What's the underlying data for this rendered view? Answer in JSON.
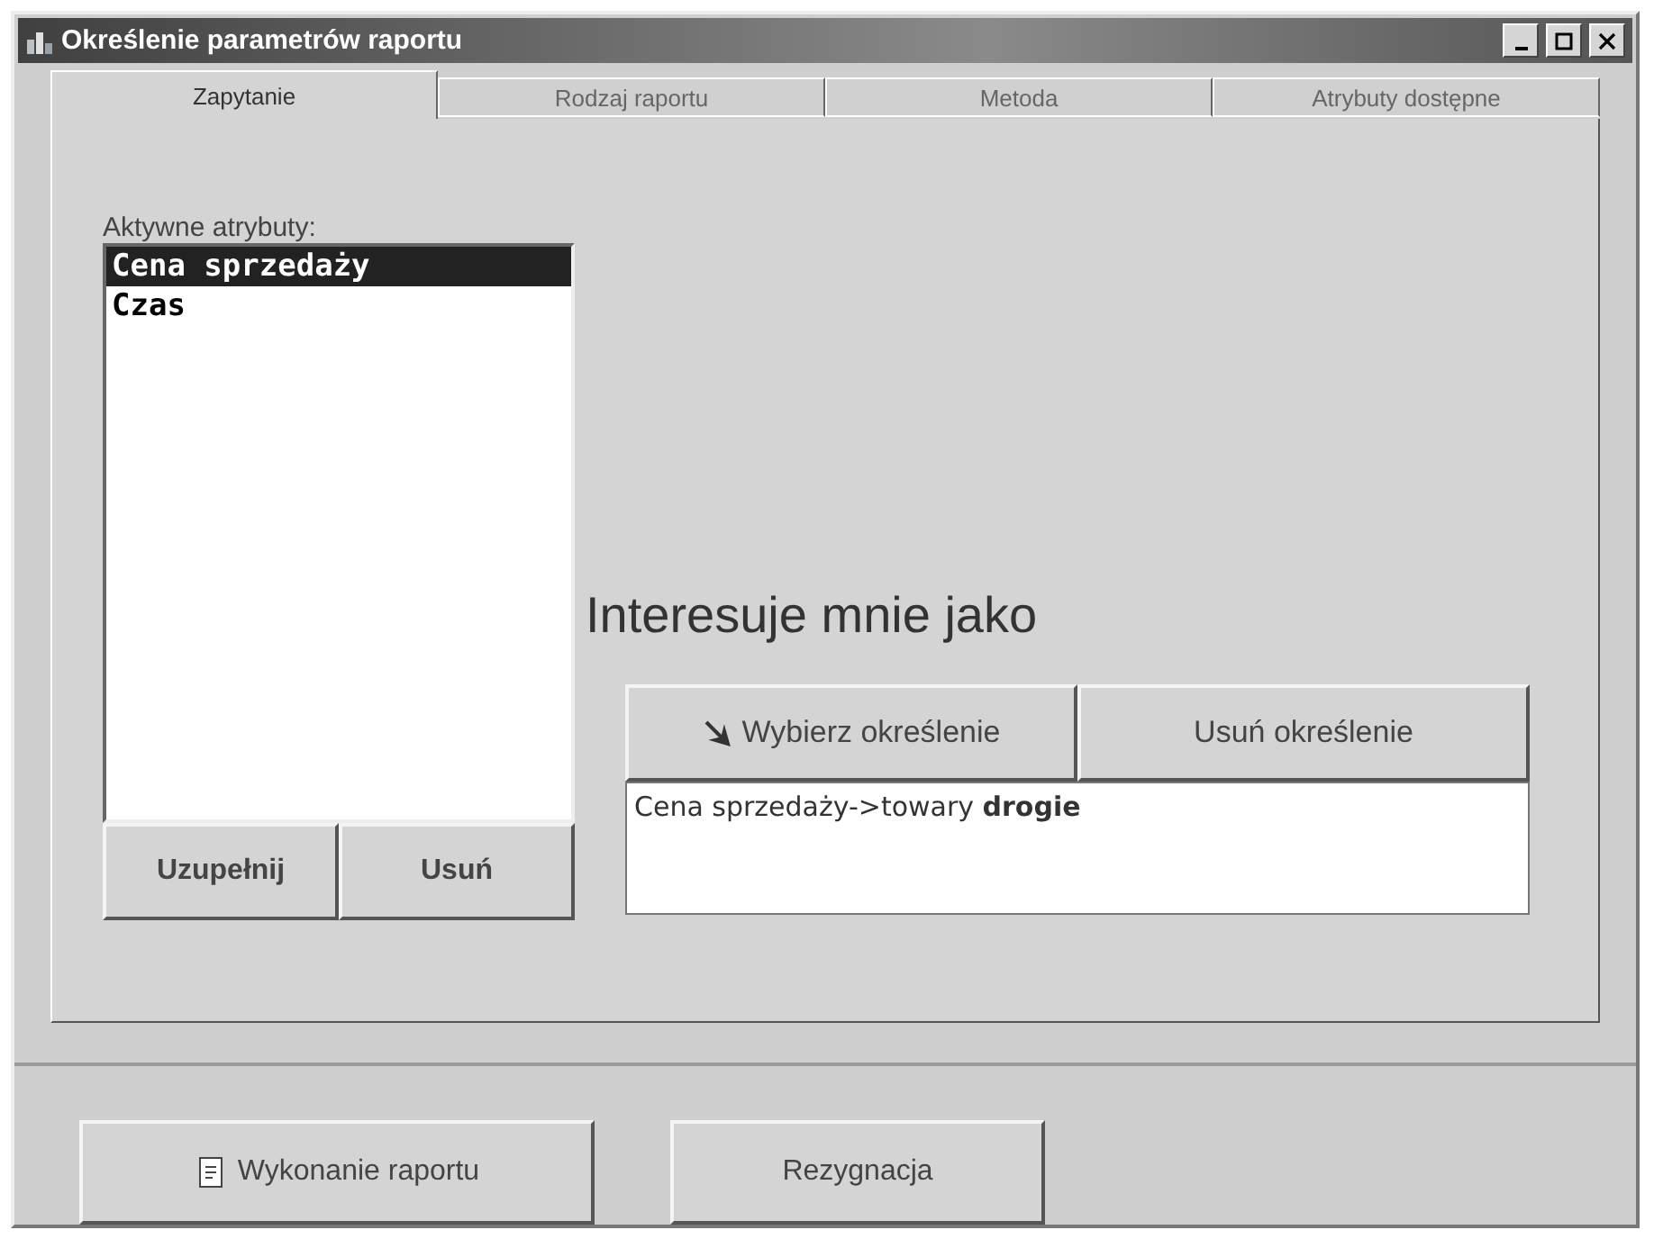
{
  "window": {
    "title": "Określenie parametrów raportu"
  },
  "tabs": [
    {
      "label": "Zapytanie",
      "selected": true
    },
    {
      "label": "Rodzaj raportu",
      "selected": false
    },
    {
      "label": "Metoda",
      "selected": false
    },
    {
      "label": "Atrybuty dostępne",
      "selected": false
    }
  ],
  "attributes": {
    "label": "Aktywne atrybuty:",
    "items": [
      {
        "label": "Cena sprzedaży",
        "selected": true
      },
      {
        "label": "Czas",
        "selected": false
      }
    ],
    "buttons": [
      "Uzupełnij",
      "Usuń"
    ]
  },
  "interest": {
    "heading": "Interesuje mnie jako",
    "buttons": [
      "Wybierz określenie",
      "Usuń określenie"
    ],
    "value": "Cena sprzedaży->towary **drogie**"
  },
  "footer_buttons": [
    "Wykonanie raportu",
    "Rezygnacja"
  ]
}
